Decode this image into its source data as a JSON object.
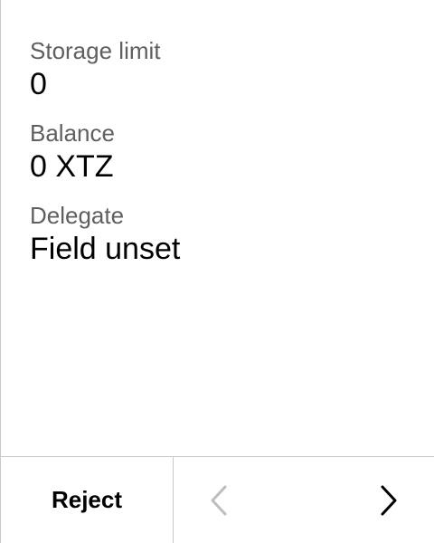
{
  "fields": [
    {
      "label": "Storage limit",
      "value": "0"
    },
    {
      "label": "Balance",
      "value": "0 XTZ"
    },
    {
      "label": "Delegate",
      "value": "Field unset"
    }
  ],
  "footer": {
    "reject_label": "Reject",
    "prev_icon": "chevron-left-icon",
    "next_icon": "chevron-right-icon",
    "prev_color": "#bdbdbd",
    "next_color": "#000000"
  },
  "colors": {
    "label": "#5f5f5f",
    "value": "#000000",
    "divider": "#c9c9c9",
    "background": "#ffffff"
  }
}
